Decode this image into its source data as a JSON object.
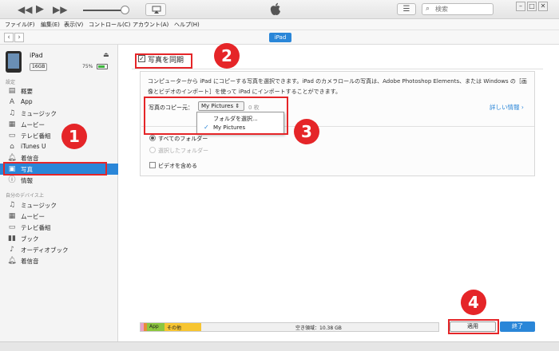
{
  "toolbar": {
    "prev_icon": "rewind-icon",
    "play_icon": "play-icon",
    "next_icon": "fast-forward-icon",
    "list_icon": "list-icon",
    "search_placeholder": "検索"
  },
  "menu": [
    "ファイル(F)",
    "編集(E)",
    "表示(V)",
    "コントロール(C)",
    "アカウント(A)",
    "ヘルプ(H)"
  ],
  "nav": {
    "device_tab": "iPad"
  },
  "device": {
    "name": "iPad",
    "capacity": "16GB",
    "battery": "75%",
    "battery_level": 0.75
  },
  "sidebar": {
    "settings_label": "設定",
    "settings_items": [
      {
        "label": "概要",
        "icon": "summary-icon"
      },
      {
        "label": "App",
        "icon": "app-icon"
      },
      {
        "label": "ミュージック",
        "icon": "music-icon"
      },
      {
        "label": "ムービー",
        "icon": "movie-icon"
      },
      {
        "label": "テレビ番組",
        "icon": "tv-icon"
      },
      {
        "label": "iTunes U",
        "icon": "itunes-u-icon"
      },
      {
        "label": "着信音",
        "icon": "ringtone-icon"
      },
      {
        "label": "写真",
        "icon": "photos-icon"
      },
      {
        "label": "情報",
        "icon": "info-icon"
      }
    ],
    "my_device_label": "自分のデバイス上",
    "my_device_items": [
      {
        "label": "ミュージック",
        "icon": "music-icon"
      },
      {
        "label": "ムービー",
        "icon": "movie-icon"
      },
      {
        "label": "テレビ番組",
        "icon": "tv-icon"
      },
      {
        "label": "ブック",
        "icon": "book-icon"
      },
      {
        "label": "オーディオブック",
        "icon": "audiobook-icon"
      },
      {
        "label": "着信音",
        "icon": "ringtone-icon"
      }
    ]
  },
  "main": {
    "sync_label": "写真を同期",
    "description": "コンピューターから iPad にコピーする写真を選択できます。iPad のカメラロールの写真は、Adobe Photoshop Elements、または Windows の［画像とビデオのインポート］を使って iPad にインポートすることができます。",
    "copy_from_label": "写真のコピー元：",
    "copy_from_value": "My Pictures",
    "photo_count": "0 枚",
    "details_link": "詳しい情報",
    "dropdown_options": [
      "フォルダを選択...",
      "My Pictures"
    ],
    "all_folders": "すべてのフォルダー",
    "selected_folders": "選択したフォルダー",
    "include_videos": "ビデオを含める"
  },
  "storage": {
    "segments": [
      "App",
      "その他"
    ],
    "free_space": "空き領域：10.38 GB",
    "apply": "適用",
    "done": "終了"
  },
  "annotations": [
    "1",
    "2",
    "3",
    "4"
  ],
  "colors": {
    "accent": "#2a86d8",
    "annotation_red": "#e52528",
    "app_segment": "#8cc63f",
    "other_segment": "#f7c531"
  }
}
